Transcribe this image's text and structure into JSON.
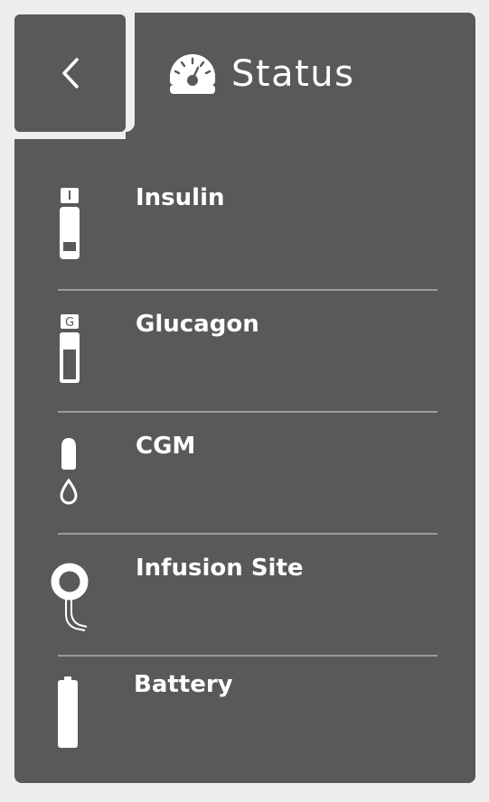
{
  "header": {
    "title": "Status",
    "title_icon": "gauge-icon",
    "back_icon": "chevron-left-icon"
  },
  "items": [
    {
      "label": "Insulin",
      "icon": "insulin-cartridge-icon",
      "icon_letter": "I"
    },
    {
      "label": "Glucagon",
      "icon": "glucagon-cartridge-icon",
      "icon_letter": "G"
    },
    {
      "label": "CGM",
      "icon": "cgm-sensor-icon"
    },
    {
      "label": "Infusion Site",
      "icon": "infusion-site-icon"
    },
    {
      "label": "Battery",
      "icon": "battery-icon"
    }
  ],
  "colors": {
    "panel": "#58595b",
    "background": "#eeeeee",
    "divider": "#9a9b9d",
    "text": "#ffffff"
  }
}
